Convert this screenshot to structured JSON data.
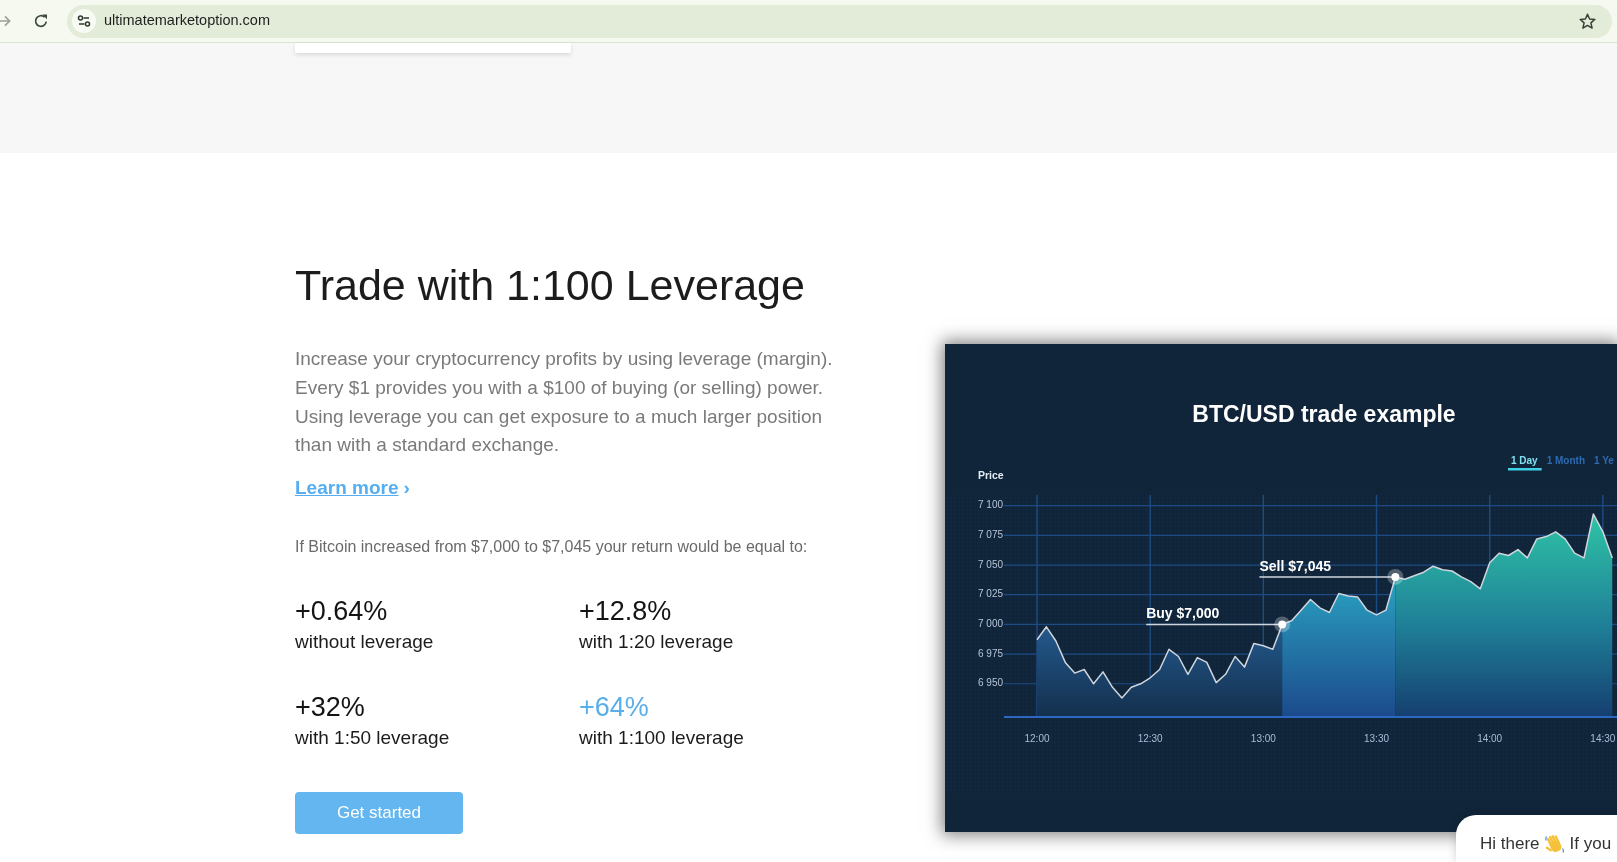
{
  "browser": {
    "forward_disabled": true,
    "url": "ultimatemarketoption.com"
  },
  "section": {
    "heading": "Trade with 1:100 Leverage",
    "description": "Increase your cryptocurrency profits by using leverage (margin). Every $1 provides you with a $100 of buying (or selling) power. Using leverage you can get exposure to a much larger position than with a standard exchange.",
    "learn_more": {
      "label": "Learn more",
      "chevron": "›"
    },
    "example": "If Bitcoin increased from $7,000 to $7,045 your return would be equal to:",
    "stats": [
      {
        "value": "+0.64%",
        "label": "without leverage",
        "highlighted": false
      },
      {
        "value": "+12.8%",
        "label": "with 1:20 leverage",
        "highlighted": false
      },
      {
        "value": "+32%",
        "label": "with 1:50 leverage",
        "highlighted": false
      },
      {
        "value": "+64%",
        "label": "with 1:100 leverage",
        "highlighted": true
      }
    ],
    "cta": "Get started"
  },
  "chart": {
    "range_tabs": [
      {
        "label": "1 Day",
        "selected": true
      },
      {
        "label": "1 Month",
        "selected": false
      },
      {
        "label": "1 Ye",
        "selected": false
      }
    ],
    "chart_data": {
      "type": "area",
      "title": "BTC/USD trade example",
      "ylabel": "Price",
      "grid": true,
      "categories": [
        "12:00",
        null,
        null,
        null,
        null,
        null,
        null,
        null,
        null,
        null,
        null,
        null,
        "12:30",
        null,
        null,
        null,
        null,
        null,
        null,
        null,
        null,
        null,
        null,
        null,
        "13:00",
        null,
        null,
        null,
        null,
        null,
        null,
        null,
        null,
        null,
        null,
        null,
        "13:30",
        null,
        null,
        null,
        null,
        null,
        null,
        null,
        null,
        null,
        null,
        null,
        "14:00",
        null,
        null,
        null,
        null,
        null,
        null,
        null,
        null,
        null,
        null,
        null,
        "14:30",
        null
      ],
      "values": [
        6987,
        6998,
        6986,
        6968,
        6959,
        6962,
        6950,
        6960,
        6947,
        6938,
        6947,
        6950,
        6955,
        6962,
        6979,
        6973,
        6958,
        6972,
        6968,
        6951,
        6958,
        6973,
        6964,
        6984,
        6982,
        6979,
        7000,
        7003,
        7012,
        7021,
        7014,
        7010,
        7026,
        7024,
        7023,
        7012,
        7008,
        7012,
        7040,
        7038,
        7041,
        7044,
        7049,
        7046,
        7045,
        7040,
        7036,
        7030,
        7052,
        7060,
        7058,
        7063,
        7056,
        7072,
        7074,
        7078,
        7072,
        7060,
        7056,
        7093,
        7078,
        7056
      ],
      "ylim": [
        6922,
        7109
      ],
      "yticks": [
        {
          "value": 6950,
          "label": "6 950"
        },
        {
          "value": 6975,
          "label": "6 975"
        },
        {
          "value": 7000,
          "label": "7 000"
        },
        {
          "value": 7025,
          "label": "7 025"
        },
        {
          "value": 7050,
          "label": "7 050"
        },
        {
          "value": 7075,
          "label": "7 075"
        },
        {
          "value": 7100,
          "label": "7 100"
        }
      ],
      "annotations": [
        "Buy $7,000",
        "Sell $7,045"
      ]
    }
  },
  "chat_widget": {
    "greeting": "Hi there",
    "message": "If you"
  }
}
